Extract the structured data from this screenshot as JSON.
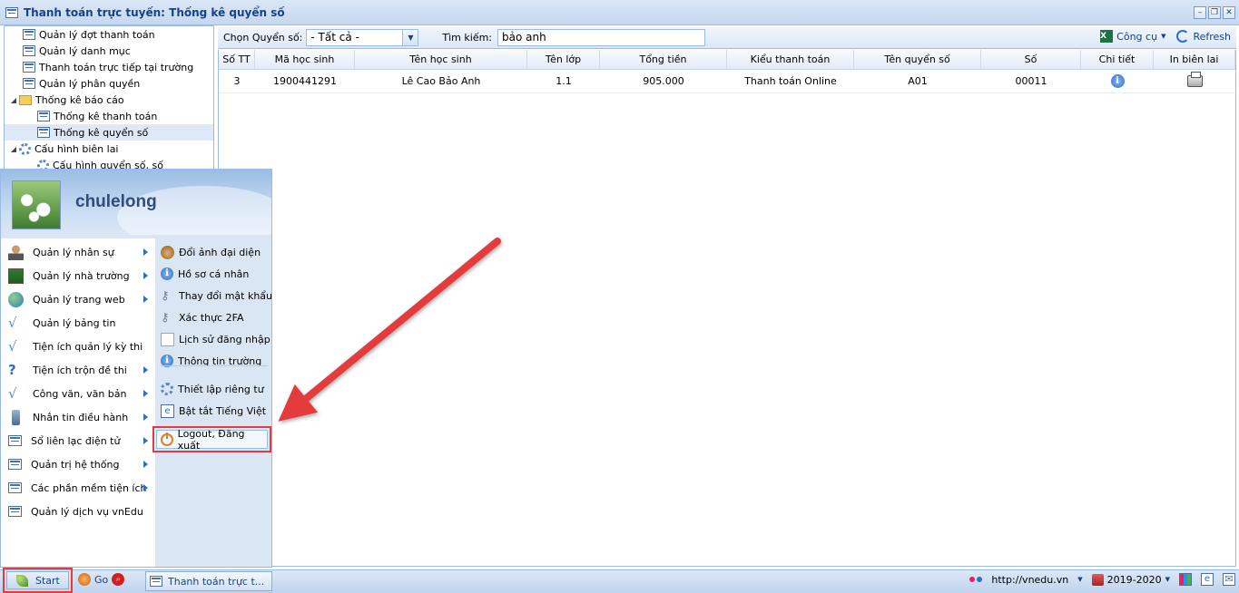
{
  "window": {
    "title": "Thanh toán trực tuyến: Thống kê quyển số",
    "buttons": [
      "–",
      "❐",
      "✕"
    ]
  },
  "tree": {
    "items": [
      {
        "label": "Quản lý đợt thanh toán",
        "icon": "list-icon",
        "indent": 1
      },
      {
        "label": "Quản lý danh mục",
        "icon": "list-icon",
        "indent": 1
      },
      {
        "label": "Thanh toán trực tiếp tại trường",
        "icon": "list-icon",
        "indent": 1
      },
      {
        "label": "Quản lý phân quyền",
        "icon": "list-icon",
        "indent": 1
      },
      {
        "label": "Thống kê báo cáo",
        "icon": "folder-icon",
        "indent": 0,
        "expanded": true
      },
      {
        "label": "Thống kê thanh toán",
        "icon": "list-icon",
        "indent": 2
      },
      {
        "label": "Thống kê quyển số",
        "icon": "list-icon",
        "indent": 2,
        "selected": true
      },
      {
        "label": "Cấu hình biên lai",
        "icon": "gear-icon",
        "indent": 0,
        "expanded": true
      },
      {
        "label": "Cấu hình quyển số, số",
        "icon": "gear-icon",
        "indent": 2
      }
    ]
  },
  "toolbar": {
    "chon_label": "Chọn Quyển số:",
    "chon_value": "- Tất cả -",
    "search_label": "Tìm kiếm:",
    "search_value": "bảo anh",
    "tools_label": "Công cụ",
    "refresh_label": "Refresh"
  },
  "grid": {
    "columns": [
      "Số TT",
      "Mã học sinh",
      "Tên học sinh",
      "Tên lớp",
      "Tổng tiền",
      "Kiểu thanh toán",
      "Tên quyển số",
      "Số",
      "Chi tiết",
      "In biên lai"
    ],
    "rows": [
      [
        "3",
        "1900441291",
        "Lê Cao Bảo Anh",
        "1.1",
        "905.000",
        "Thanh toán Online",
        "A01",
        "00011"
      ]
    ]
  },
  "startmenu": {
    "username": "chulelong",
    "left_items": [
      {
        "label": "Quản lý nhân sự",
        "submenu": true
      },
      {
        "label": "Quản lý nhà trường",
        "submenu": true
      },
      {
        "label": "Quản lý trang web",
        "submenu": true
      },
      {
        "label": "Quản lý bảng tin",
        "submenu": false
      },
      {
        "label": "Tiện ích quản lý kỳ thi",
        "submenu": false
      },
      {
        "label": "Tiện ích trộn đề thi",
        "submenu": true
      },
      {
        "label": "Công văn, văn bản",
        "submenu": true
      },
      {
        "label": "Nhắn tin điều hành",
        "submenu": true
      },
      {
        "label": "Sổ liên lạc điện tử",
        "submenu": true
      },
      {
        "label": "Quản trị hệ thống",
        "submenu": true
      },
      {
        "label": "Các phần mềm tiện ích",
        "submenu": true
      },
      {
        "label": "Quản lý dịch vụ vnEdu",
        "submenu": false
      }
    ],
    "right_items": [
      "Đổi ảnh đại diện",
      "Hồ sơ cá nhân",
      "Thay đổi mật khẩu",
      "Xác thực 2FA",
      "Lịch sử đăng nhập",
      "Thông tin trường",
      "Thiết lập riêng tư",
      "Bật tắt Tiếng Việt"
    ],
    "logout_label": "Logout, Đăng xuất"
  },
  "taskbar": {
    "start_label": "Start",
    "go_label": "Go",
    "task_label": "Thanh toán trực t...",
    "url": "http://vnedu.vn",
    "year": "2019-2020"
  },
  "colors": {
    "highlight_red": "#e43c3c",
    "accent_blue": "#15428b"
  }
}
